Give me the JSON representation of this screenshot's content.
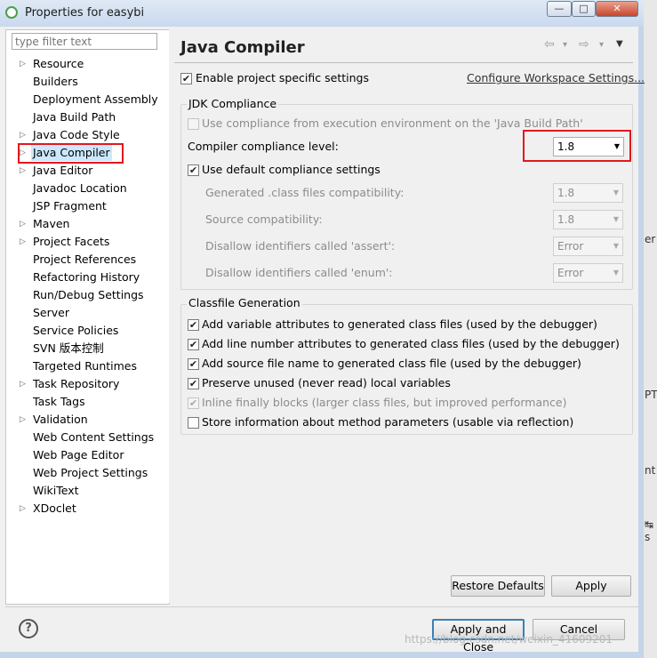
{
  "window": {
    "title": "Properties for easybi",
    "minimize": "—",
    "maximize": "□",
    "close": "✕"
  },
  "sidebar": {
    "filter_placeholder": "type filter text",
    "items": [
      {
        "label": "Resource",
        "expandable": true
      },
      {
        "label": "Builders",
        "expandable": false
      },
      {
        "label": "Deployment Assembly",
        "expandable": false
      },
      {
        "label": "Java Build Path",
        "expandable": false
      },
      {
        "label": "Java Code Style",
        "expandable": true
      },
      {
        "label": "Java Compiler",
        "expandable": true,
        "selected": true
      },
      {
        "label": "Java Editor",
        "expandable": true
      },
      {
        "label": "Javadoc Location",
        "expandable": false
      },
      {
        "label": "JSP Fragment",
        "expandable": false
      },
      {
        "label": "Maven",
        "expandable": true
      },
      {
        "label": "Project Facets",
        "expandable": true
      },
      {
        "label": "Project References",
        "expandable": false
      },
      {
        "label": "Refactoring History",
        "expandable": false
      },
      {
        "label": "Run/Debug Settings",
        "expandable": false
      },
      {
        "label": "Server",
        "expandable": false
      },
      {
        "label": "Service Policies",
        "expandable": false
      },
      {
        "label": "SVN 版本控制",
        "expandable": false
      },
      {
        "label": "Targeted Runtimes",
        "expandable": false
      },
      {
        "label": "Task Repository",
        "expandable": true
      },
      {
        "label": "Task Tags",
        "expandable": false
      },
      {
        "label": "Validation",
        "expandable": true
      },
      {
        "label": "Web Content Settings",
        "expandable": false
      },
      {
        "label": "Web Page Editor",
        "expandable": false
      },
      {
        "label": "Web Project Settings",
        "expandable": false
      },
      {
        "label": "WikiText",
        "expandable": false
      },
      {
        "label": "XDoclet",
        "expandable": true
      }
    ]
  },
  "main": {
    "title": "Java Compiler",
    "nav": {
      "back": "⇦",
      "back_menu": "▾",
      "forward": "⇨",
      "forward_menu": "▾",
      "view_menu": "▼"
    },
    "enable_specific": {
      "label": "Enable project specific settings",
      "checked": true
    },
    "configure_link": "Configure Workspace Settings...",
    "jdk": {
      "group_title": "JDK Compliance",
      "use_ee": {
        "label": "Use compliance from execution environment on the 'Java Build Path'",
        "checked": false
      },
      "compliance_level_label": "Compiler compliance level:",
      "compliance_level_value": "1.8",
      "use_default": {
        "label": "Use default compliance settings",
        "checked": true
      },
      "rows": [
        {
          "label": "Generated .class files compatibility:",
          "value": "1.8"
        },
        {
          "label": "Source compatibility:",
          "value": "1.8"
        },
        {
          "label": "Disallow identifiers called 'assert':",
          "value": "Error"
        },
        {
          "label": "Disallow identifiers called 'enum':",
          "value": "Error"
        }
      ]
    },
    "classfile": {
      "group_title": "Classfile Generation",
      "options": [
        {
          "label": "Add variable attributes to generated class files (used by the debugger)",
          "checked": true,
          "enabled": true
        },
        {
          "label": "Add line number attributes to generated class files (used by the debugger)",
          "checked": true,
          "enabled": true
        },
        {
          "label": "Add source file name to generated class file (used by the debugger)",
          "checked": true,
          "enabled": true
        },
        {
          "label": "Preserve unused (never read) local variables",
          "checked": true,
          "enabled": true
        },
        {
          "label": "Inline finally blocks (larger class files, but improved performance)",
          "checked": true,
          "enabled": false
        },
        {
          "label": "Store information about method parameters (usable via reflection)",
          "checked": false,
          "enabled": true
        }
      ]
    },
    "restore_defaults": "Restore Defaults",
    "apply": "Apply"
  },
  "footer": {
    "help": "?",
    "apply_and_close": "Apply and Close",
    "cancel": "Cancel"
  },
  "background_text": [
    "er",
    "PT",
    "nt",
    "↹ s"
  ],
  "watermark": "https://blog.csdn.net/weixin_41609201"
}
